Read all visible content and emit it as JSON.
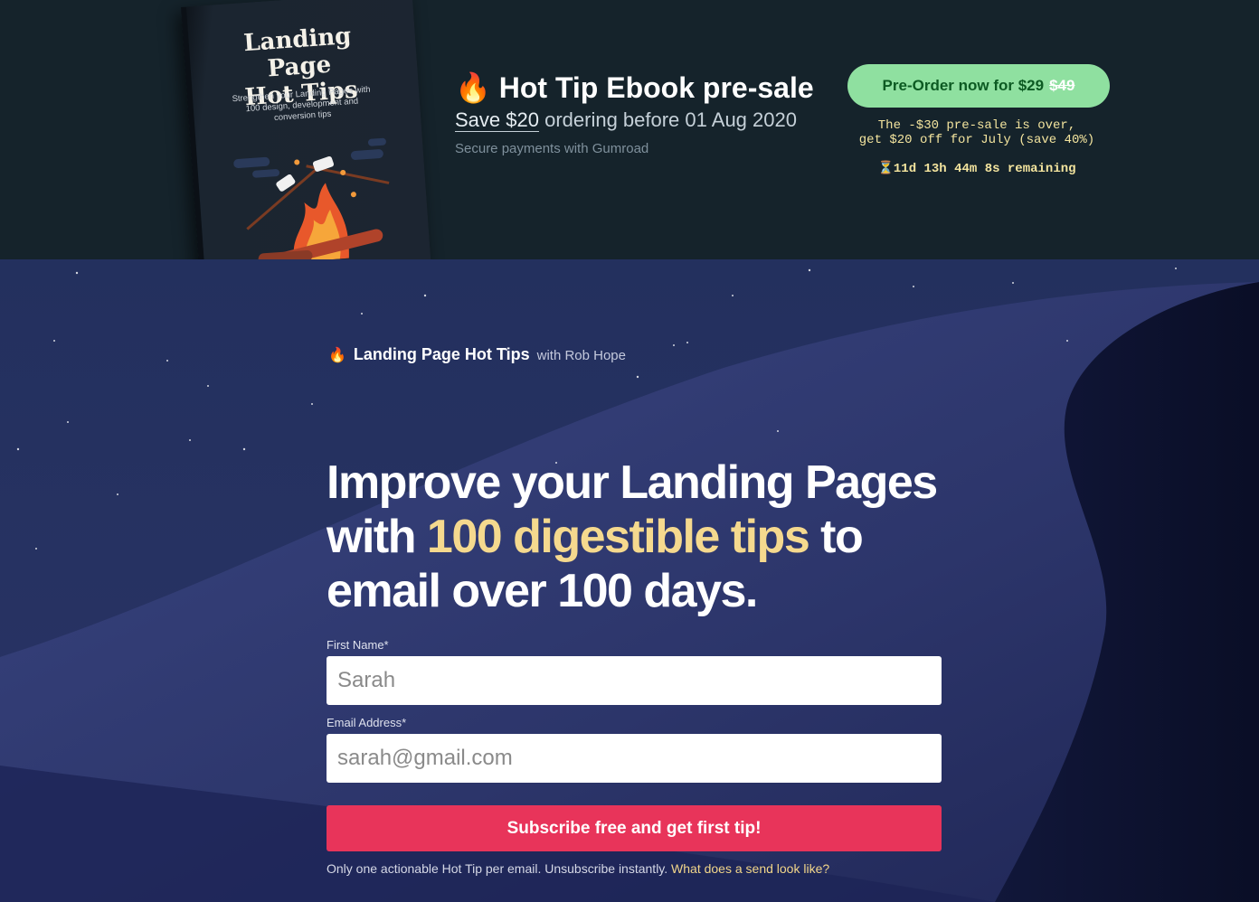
{
  "promo": {
    "book": {
      "title_line1": "Landing Page",
      "title_line2": "Hot Tips",
      "subtitle": "Strengthen your Landing Pages with 100 design, development and conversion tips"
    },
    "title_emoji": "🔥",
    "title": "Hot Tip Ebook pre-sale",
    "save_link": "Save $20",
    "save_rest": " ordering before 01 Aug 2020",
    "secure": "Secure payments with Gumroad",
    "preorder_label": "Pre-Order now for $29",
    "preorder_old_price": "$49",
    "presale_note_line1": "The -$30 pre-sale is over,",
    "presale_note_line2": "get $20 off for July (save 40%)",
    "countdown": "⏳11d 13h 44m 8s remaining"
  },
  "hero": {
    "brand_emoji": "🔥",
    "brand_name": "Landing Page Hot Tips",
    "brand_by": "with Rob Hope",
    "headline_part1": "Improve your Landing Pages with ",
    "headline_highlight": "100 digestible tips",
    "headline_part2": " to email over 100 days.",
    "first_name_label": "First Name*",
    "first_name_placeholder": "Sarah",
    "email_label": "Email Address*",
    "email_placeholder": "sarah@gmail.com",
    "subscribe_label": "Subscribe free and get first tip!",
    "footnote_text": "Only one actionable Hot Tip per email. Unsubscribe instantly. ",
    "footnote_link": "What does a send look like?"
  },
  "colors": {
    "accent_green": "#8fe0a0",
    "accent_red": "#e8345a",
    "highlight_yellow": "#f5d98e"
  }
}
